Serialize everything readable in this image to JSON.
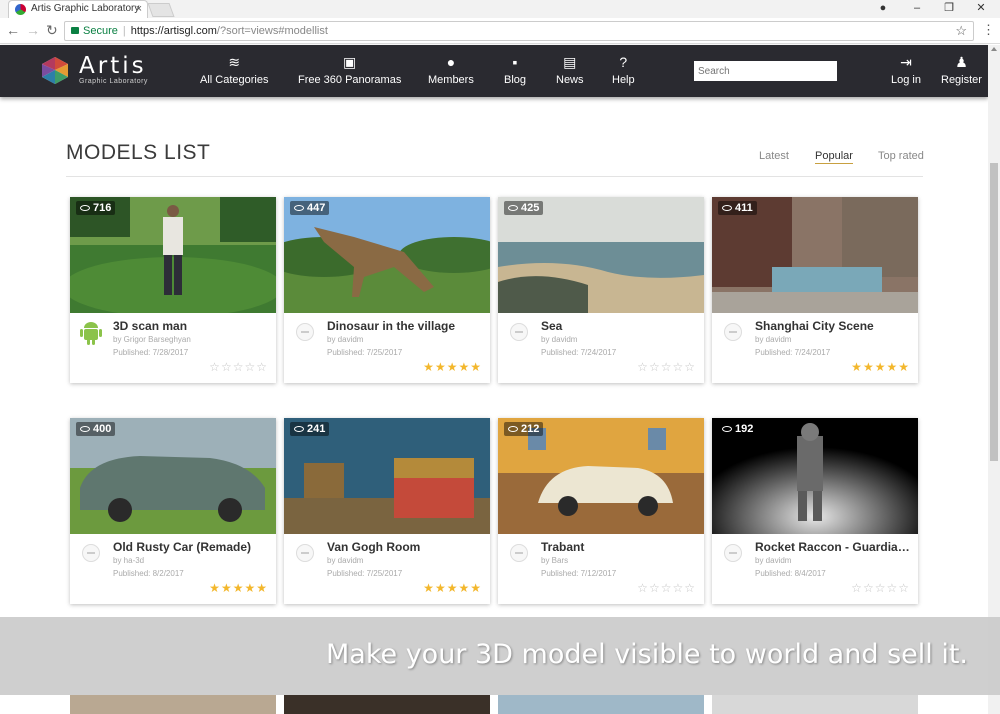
{
  "browser": {
    "tab_title": "Artis Graphic Laboratory",
    "secure_label": "Secure",
    "url_host": "https://artisgl.com",
    "url_rest": "/?sort=views#modellist"
  },
  "site": {
    "logo_title": "Artis",
    "logo_subtitle": "Graphic Laboratory",
    "nav": [
      {
        "label": "All Categories",
        "icon": "layers-icon"
      },
      {
        "label": "Free 360 Panoramas",
        "icon": "image-icon"
      },
      {
        "label": "Members",
        "icon": "members-icon"
      },
      {
        "label": "Blog",
        "icon": "chat-icon"
      },
      {
        "label": "News",
        "icon": "newspaper-icon"
      },
      {
        "label": "Help",
        "icon": "help-icon"
      }
    ],
    "search_placeholder": "Search",
    "login_label": "Log in",
    "register_label": "Register"
  },
  "main": {
    "title": "MODELS LIST",
    "sort": [
      {
        "label": "Latest",
        "active": false
      },
      {
        "label": "Popular",
        "active": true
      },
      {
        "label": "Top rated",
        "active": false
      }
    ]
  },
  "models": [
    {
      "views": "716",
      "title": "3D scan man",
      "author": "by Grigor Barseghyan",
      "published": "Published: 7/28/2017",
      "rating": 0
    },
    {
      "views": "447",
      "title": "Dinosaur in the village",
      "author": "by davidm",
      "published": "Published: 7/25/2017",
      "rating": 5
    },
    {
      "views": "425",
      "title": "Sea",
      "author": "by davidm",
      "published": "Published: 7/24/2017",
      "rating": 0
    },
    {
      "views": "411",
      "title": "Shanghai City Scene",
      "author": "by davidm",
      "published": "Published: 7/24/2017",
      "rating": 5
    },
    {
      "views": "400",
      "title": "Old Rusty Car (Remade)",
      "author": "by ha-3d",
      "published": "Published: 8/2/2017",
      "rating": 5
    },
    {
      "views": "241",
      "title": "Van Gogh Room",
      "author": "by davidm",
      "published": "Published: 7/25/2017",
      "rating": 5
    },
    {
      "views": "212",
      "title": "Trabant",
      "author": "by Bars",
      "published": "Published: 7/12/2017",
      "rating": 0
    },
    {
      "views": "192",
      "title": "Rocket Raccon - Guardians of the Galaxy",
      "author": "by davidm",
      "published": "Published: 8/4/2017",
      "rating": 0
    }
  ],
  "banner": {
    "text": "Make your 3D model visible to world and sell it."
  },
  "colors": {
    "nav_bg": "#2a2a30",
    "star_on": "#f3b72c",
    "star_off": "#c5c5c5",
    "secure": "#0b8043"
  }
}
